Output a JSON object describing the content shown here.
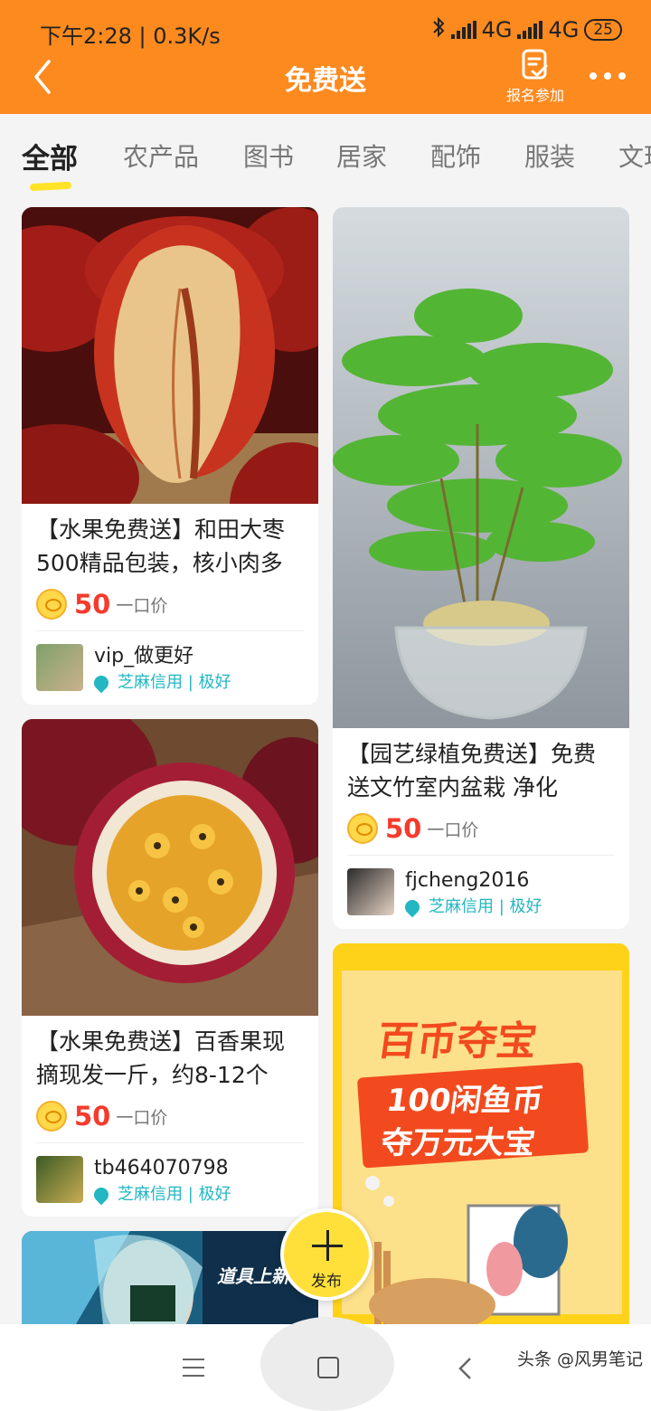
{
  "status": {
    "time": "下午2:28",
    "speed": "0.3K/s",
    "net1": "4G",
    "net2": "4G",
    "battery": "25"
  },
  "header": {
    "title": "免费送",
    "signup_label": "报名参加"
  },
  "tabs": [
    "全部",
    "农产品",
    "图书",
    "居家",
    "配饰",
    "服装",
    "文玩"
  ],
  "items": [
    {
      "title": "【水果免费送】和田大枣500精品包装，核小肉多",
      "price": "50",
      "price_unit": "一口价",
      "user": "vip_做更好",
      "credit": "芝麻信用 | 极好"
    },
    {
      "title": "【园艺绿植免费送】免费送文竹室内盆栽 净化",
      "price": "50",
      "price_unit": "一口价",
      "user": "fjcheng2016",
      "credit": "芝麻信用 | 极好"
    },
    {
      "title": "【水果免费送】百香果现摘现发一斤，约8-12个",
      "price": "50",
      "price_unit": "一口价",
      "user": "tb464070798",
      "credit": "芝麻信用 | 极好"
    }
  ],
  "promo": {
    "title": "百币夺宝",
    "line1": "100闲鱼币",
    "line2": "夺万元大宝"
  },
  "game_banner_text": "道具上新",
  "fab_label": "发布",
  "watermark": "头条 @风男笔记",
  "colors": {
    "brand": "#fd8a1f",
    "price": "#f53b2d",
    "accent": "#ffe03a",
    "credit": "#22b7c2"
  }
}
